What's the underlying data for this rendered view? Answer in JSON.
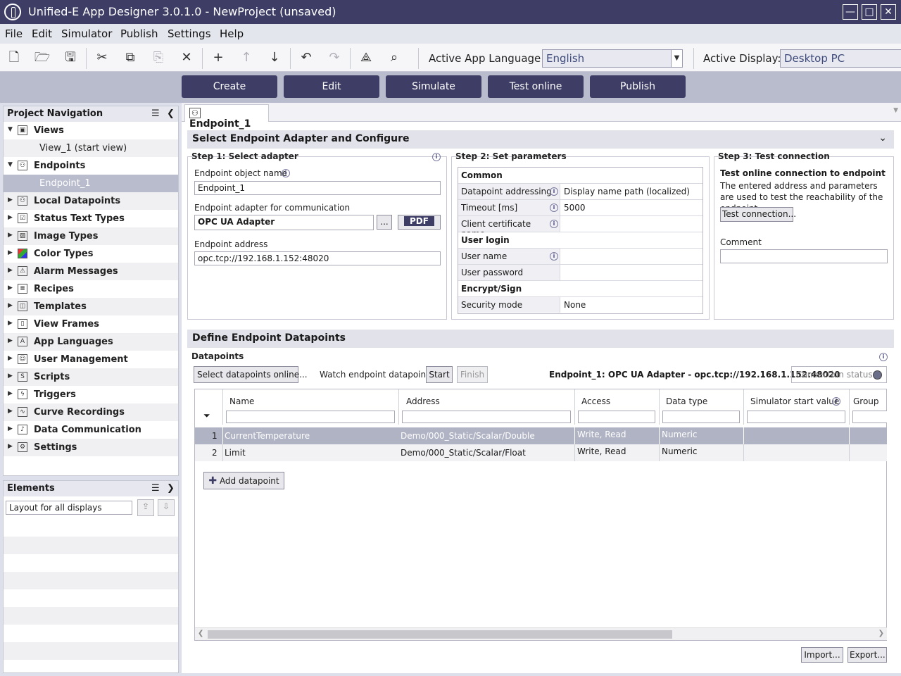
{
  "window": {
    "title": "Unified-E App Designer 3.0.1.0 - NewProject  (unsaved)",
    "controls": {
      "minimize": "—",
      "maximize": "□",
      "close": "✕"
    }
  },
  "menu": [
    "File",
    "Edit",
    "Simulator",
    "Publish",
    "Settings",
    "Help"
  ],
  "toolbar": {
    "icons": [
      "new-file-icon",
      "open-folder-icon",
      "save-icon",
      "cut-icon",
      "copy-icon",
      "paste-icon",
      "delete-icon",
      "add-icon",
      "move-up-icon",
      "move-down-icon",
      "undo-icon",
      "redo-icon",
      "tree-icon",
      "search-icon"
    ],
    "language_label": "Active App Language:",
    "language_value": "English",
    "display_label": "Active Display:",
    "display_value": "Desktop PC"
  },
  "actions": [
    "Create",
    "Edit",
    "Simulate",
    "Test online",
    "Publish"
  ],
  "nav": {
    "title": "Project Navigation",
    "items": [
      {
        "label": "Views",
        "expanded": true,
        "icon": "views-icon"
      },
      {
        "label": "View_1 (start view)",
        "child": true
      },
      {
        "label": "Endpoints",
        "expanded": true,
        "icon": "endpoint-icon"
      },
      {
        "label": "Endpoint_1",
        "child": true,
        "selected": true
      },
      {
        "label": "Local Datapoints",
        "icon": "local-datapoint-icon"
      },
      {
        "label": "Status Text Types",
        "icon": "status-text-icon"
      },
      {
        "label": "Image Types",
        "icon": "image-icon"
      },
      {
        "label": "Color Types",
        "icon": "color-icon"
      },
      {
        "label": "Alarm Messages",
        "icon": "alarm-icon"
      },
      {
        "label": "Recipes",
        "icon": "recipes-icon"
      },
      {
        "label": "Templates",
        "icon": "templates-icon"
      },
      {
        "label": "View Frames",
        "icon": "view-frames-icon"
      },
      {
        "label": "App Languages",
        "icon": "languages-icon"
      },
      {
        "label": "User Management",
        "icon": "user-icon"
      },
      {
        "label": "Scripts",
        "icon": "scripts-icon"
      },
      {
        "label": "Triggers",
        "icon": "triggers-icon"
      },
      {
        "label": "Curve Recordings",
        "icon": "curve-icon"
      },
      {
        "label": "Data Communication",
        "icon": "data-communication-icon"
      },
      {
        "label": "Settings",
        "icon": "settings-icon"
      }
    ]
  },
  "elements": {
    "title": "Elements",
    "layout_value": "Layout for all displays"
  },
  "tab": {
    "label": "Endpoint_1"
  },
  "configure": {
    "title": "Select Endpoint Adapter and Configure",
    "step1": {
      "title": "Step 1: Select adapter",
      "name_label": "Endpoint object name",
      "name_value": "Endpoint_1",
      "adapter_label": "Endpoint adapter for communication",
      "adapter_value": "OPC UA Adapter",
      "browse_label": "...",
      "pdf_label": "PDF",
      "address_label": "Endpoint address",
      "address_value": "opc.tcp://192.168.1.152:48020"
    },
    "step2": {
      "title": "Step 2: Set parameters",
      "rows": [
        {
          "key": "Common",
          "group": true
        },
        {
          "key": "Datapoint addressing",
          "value": "Display name path (localized)",
          "info": true
        },
        {
          "key": "Timeout [ms]",
          "value": "5000",
          "info": true
        },
        {
          "key": "Client certificate name",
          "value": "",
          "info": true
        },
        {
          "key": "User login",
          "group": true
        },
        {
          "key": "User name",
          "value": "",
          "info": true
        },
        {
          "key": "User password",
          "value": ""
        },
        {
          "key": "Encrypt/Sign",
          "group": true
        },
        {
          "key": "Security mode",
          "value": "None"
        }
      ]
    },
    "step3": {
      "title": "Step 3: Test connection",
      "heading": "Test online connection to endpoint",
      "description": "The entered address and parameters are used to test the reachability of the endpoint.",
      "test_button": "Test connection...",
      "comment_label": "Comment",
      "comment_value": ""
    }
  },
  "datapoints": {
    "title": "Define Endpoint Datapoints",
    "subtitle": "Datapoints",
    "select_button": "Select datapoints online...",
    "watch_label": "Watch endpoint datapoints:",
    "start_button": "Start",
    "finish_button": "Finish",
    "endpoint_summary": "Endpoint_1: OPC UA Adapter - opc.tcp://192.168.1.152:48020",
    "connection_status": "Connection status:",
    "columns": [
      "Name",
      "Address",
      "Access",
      "Data type",
      "Simulator start value",
      "Group"
    ],
    "rows": [
      {
        "num": "1",
        "name": "CurrentTemperature",
        "address": "Demo/000_Static/Scalar/Double",
        "access": "Write, Read",
        "type": "Numeric",
        "start": "",
        "group": ""
      },
      {
        "num": "2",
        "name": "Limit",
        "address": "Demo/000_Static/Scalar/Float",
        "access": "Write, Read",
        "type": "Numeric",
        "start": "",
        "group": ""
      }
    ],
    "add_button": "Add datapoint",
    "import_button": "Import...",
    "export_button": "Export..."
  }
}
